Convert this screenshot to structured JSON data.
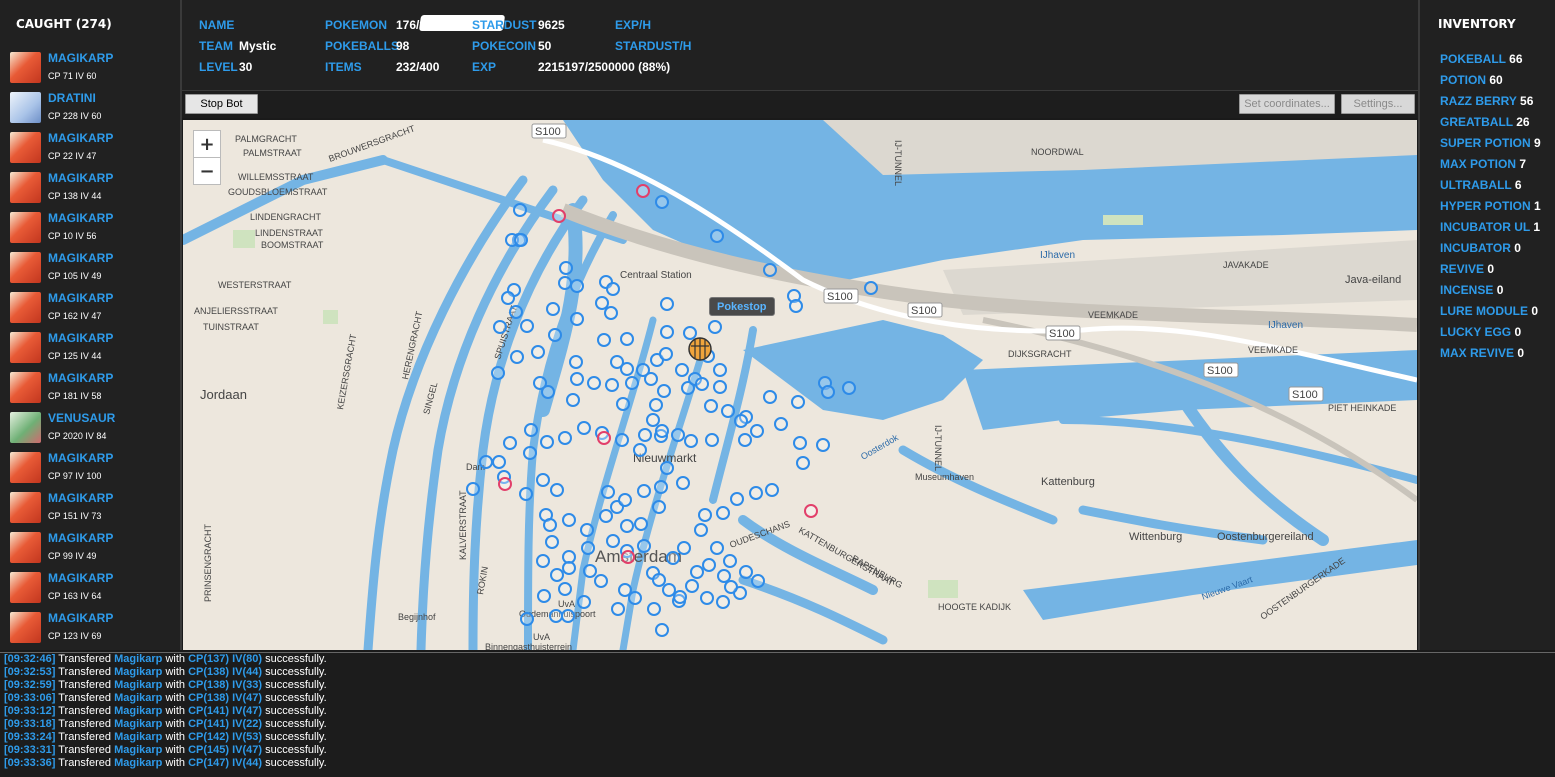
{
  "caught": {
    "title": "CAUGHT (274)",
    "items": [
      {
        "name": "MAGIKARP",
        "stats": "CP 71 IV 60",
        "thumb": "magikarp"
      },
      {
        "name": "DRATINI",
        "stats": "CP 228 IV 60",
        "thumb": "dratini"
      },
      {
        "name": "MAGIKARP",
        "stats": "CP 22 IV 47",
        "thumb": "magikarp"
      },
      {
        "name": "MAGIKARP",
        "stats": "CP 138 IV 44",
        "thumb": "magikarp"
      },
      {
        "name": "MAGIKARP",
        "stats": "CP 10 IV 56",
        "thumb": "magikarp"
      },
      {
        "name": "MAGIKARP",
        "stats": "CP 105 IV 49",
        "thumb": "magikarp"
      },
      {
        "name": "MAGIKARP",
        "stats": "CP 162 IV 47",
        "thumb": "magikarp"
      },
      {
        "name": "MAGIKARP",
        "stats": "CP 125 IV 44",
        "thumb": "magikarp"
      },
      {
        "name": "MAGIKARP",
        "stats": "CP 181 IV 58",
        "thumb": "magikarp"
      },
      {
        "name": "VENUSAUR",
        "stats": "CP 2020 IV 84",
        "thumb": "venusaur"
      },
      {
        "name": "MAGIKARP",
        "stats": "CP 97 IV 100",
        "thumb": "magikarp"
      },
      {
        "name": "MAGIKARP",
        "stats": "CP 151 IV 73",
        "thumb": "magikarp"
      },
      {
        "name": "MAGIKARP",
        "stats": "CP 99 IV 49",
        "thumb": "magikarp"
      },
      {
        "name": "MAGIKARP",
        "stats": "CP 163 IV 64",
        "thumb": "magikarp"
      },
      {
        "name": "MAGIKARP",
        "stats": "CP 123 IV 69",
        "thumb": "magikarp"
      }
    ]
  },
  "stats": {
    "name_label": "NAME",
    "team_label": "TEAM",
    "team_value": "Mystic",
    "level_label": "LEVEL",
    "level_value": "30",
    "pokemon_label": "POKEMON",
    "pokemon_value": "176/300",
    "pokeballs_label": "POKEBALLS",
    "pokeballs_value": "98",
    "items_label": "ITEMS",
    "items_value": "232/400",
    "stardust_label": "STARDUST",
    "stardust_value": "9625",
    "pokecoin_label": "POKECOIN",
    "pokecoin_value": "50",
    "exp_label": "EXP",
    "exp_value": "2215197/2500000 (88%)",
    "exph_label": "EXP/H",
    "stardusth_label": "STARDUST/H"
  },
  "toolbar": {
    "stop_label": "Stop Bot",
    "set_coords_label": "Set coordinates...",
    "settings_label": "Settings..."
  },
  "map": {
    "zoom_in": "+",
    "zoom_out": "−",
    "tooltip": "Pokestop",
    "labels": {
      "s100": "S100",
      "centraal": "Centraal Station",
      "nieuwmarkt": "Nieuwmarkt",
      "amsterdam": "Amsterdam",
      "jordaan": "Jordaan",
      "kattenburg": "Kattenburg",
      "wittenburg": "Wittenburg",
      "oostenburgereiland": "Oostenburgereiland",
      "java": "Java-eiland",
      "ijhaven": "IJhaven",
      "museumhaven": "Museumhaven",
      "dijksgracht": "DIJKSGRACHT",
      "piet_heinkade": "PIET HEINKADE",
      "veemkade": "VEEMKADE",
      "javakade": "JAVAKADE",
      "noordwal": "NOORDWAL",
      "ij_tunnel": "IJ-TUNNEL",
      "brouwersgracht": "BROUWERSGRACHT",
      "palmgracht": "PALMGRACHT",
      "palmstraat": "PALMSTRAAT",
      "willemsstraat": "WILLEMSSTRAAT",
      "goudsbloemstraat": "GOUDSBLOEMSTRAAT",
      "lindengracht": "LINDENGRACHT",
      "lindenstraat": "LINDENSTRAAT",
      "boomstraat": "BOOMSTRAAT",
      "westerstraat": "WESTERSTRAAT",
      "anjeliersstraat": "ANJELIERSSTRAAT",
      "tuinstraat": "TUINSTRAAT",
      "prinsengracht": "PRINSENGRACHT",
      "keizersgracht": "KEIZERSGRACHT",
      "herengracht": "HERENGRACHT",
      "singel": "SINGEL",
      "spuistraat": "SPUISTRAAT",
      "kattenburgerstraat": "KATTENBURGERSTRAAT",
      "rapenburg": "RAPENBURG",
      "oudeschans": "OUDESCHANS",
      "begijnhof": "Begijnhof",
      "uva": "UvA",
      "oudemanhuispoort": "Oudemanhuispoort",
      "binnengasthuisterrein": "Binnengasthuisterrein",
      "dam": "Dam",
      "ostenburgerkade": "OOSTENBURGERKADE",
      "nieuwe_vaart": "Nieuwe Vaart",
      "oosterdok": "Oosterdok",
      "hoogte_kadijk": "HOOGTE KADIJK",
      "rokin": "ROKIN",
      "kalverstraat": "KALVERSTRAAT"
    }
  },
  "inventory": {
    "title": "INVENTORY",
    "items": [
      {
        "name": "POKEBALL",
        "count": "66"
      },
      {
        "name": "POTION",
        "count": "60"
      },
      {
        "name": "RAZZ BERRY",
        "count": "56"
      },
      {
        "name": "GREATBALL",
        "count": "26"
      },
      {
        "name": "SUPER POTION",
        "count": "9"
      },
      {
        "name": "MAX POTION",
        "count": "7"
      },
      {
        "name": "ULTRABALL",
        "count": "6"
      },
      {
        "name": "HYPER POTION",
        "count": "1"
      },
      {
        "name": "INCUBATOR UL",
        "count": "1"
      },
      {
        "name": "INCUBATOR",
        "count": "0"
      },
      {
        "name": "REVIVE",
        "count": "0"
      },
      {
        "name": "INCENSE",
        "count": "0"
      },
      {
        "name": "LURE MODULE",
        "count": "0"
      },
      {
        "name": "LUCKY EGG",
        "count": "0"
      },
      {
        "name": "MAX REVIVE",
        "count": "0"
      }
    ]
  },
  "log": [
    {
      "time": "[09:32:46]",
      "verb": "Transfered",
      "pokemon": "Magikarp",
      "with": "with",
      "cpiv": "CP(137) IV(80)",
      "result": "successfully."
    },
    {
      "time": "[09:32:53]",
      "verb": "Transfered",
      "pokemon": "Magikarp",
      "with": "with",
      "cpiv": "CP(138) IV(44)",
      "result": "successfully."
    },
    {
      "time": "[09:32:59]",
      "verb": "Transfered",
      "pokemon": "Magikarp",
      "with": "with",
      "cpiv": "CP(138) IV(33)",
      "result": "successfully."
    },
    {
      "time": "[09:33:06]",
      "verb": "Transfered",
      "pokemon": "Magikarp",
      "with": "with",
      "cpiv": "CP(138) IV(47)",
      "result": "successfully."
    },
    {
      "time": "[09:33:12]",
      "verb": "Transfered",
      "pokemon": "Magikarp",
      "with": "with",
      "cpiv": "CP(141) IV(47)",
      "result": "successfully."
    },
    {
      "time": "[09:33:18]",
      "verb": "Transfered",
      "pokemon": "Magikarp",
      "with": "with",
      "cpiv": "CP(141) IV(22)",
      "result": "successfully."
    },
    {
      "time": "[09:33:24]",
      "verb": "Transfered",
      "pokemon": "Magikarp",
      "with": "with",
      "cpiv": "CP(142) IV(53)",
      "result": "successfully."
    },
    {
      "time": "[09:33:31]",
      "verb": "Transfered",
      "pokemon": "Magikarp",
      "with": "with",
      "cpiv": "CP(145) IV(47)",
      "result": "successfully."
    },
    {
      "time": "[09:33:36]",
      "verb": "Transfered",
      "pokemon": "Magikarp",
      "with": "with",
      "cpiv": "CP(147) IV(44)",
      "result": "successfully."
    }
  ],
  "colors": {
    "accent": "#2e9bea",
    "water": "#74b4e4",
    "land": "#ede7dd",
    "pokestop": "#2e8be8",
    "lured": "#e23f6a"
  }
}
